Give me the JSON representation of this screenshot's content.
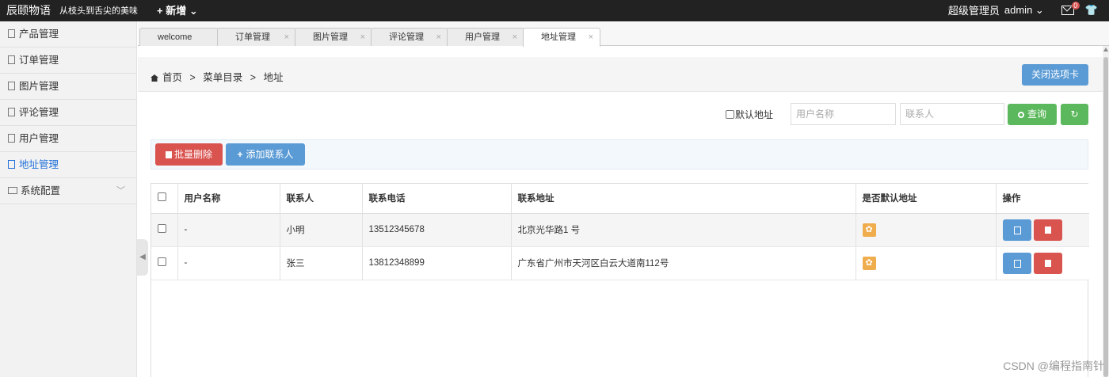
{
  "header": {
    "brand": "辰颐物语",
    "slogan": "从枝头到舌尖的美味",
    "new_label": "+ 新增 ⌄",
    "role": "超级管理员",
    "user": "admin ⌄",
    "mail_badge": "0"
  },
  "sidebar": {
    "items": [
      {
        "label": "产品管理"
      },
      {
        "label": "订单管理"
      },
      {
        "label": "图片管理"
      },
      {
        "label": "评论管理"
      },
      {
        "label": "用户管理"
      },
      {
        "label": "地址管理"
      },
      {
        "label": "系统配置"
      }
    ],
    "active_index": 5
  },
  "tabs": [
    {
      "label": "welcome"
    },
    {
      "label": "订单管理"
    },
    {
      "label": "图片管理"
    },
    {
      "label": "评论管理"
    },
    {
      "label": "用户管理"
    },
    {
      "label": "地址管理"
    }
  ],
  "breadcrumb": {
    "home": "首页",
    "sep": ">",
    "menu": "菜单目录",
    "current": "地址"
  },
  "close_tabs_label": "关闭选项卡",
  "search": {
    "default_label": "默认地址",
    "username_placeholder": "用户名称",
    "contact_placeholder": "联系人",
    "search_label": "查询"
  },
  "actions": {
    "batch_delete": "批量删除",
    "add_contact": "添加联系人"
  },
  "table": {
    "headers": [
      "用户名称",
      "联系人",
      "联系电话",
      "联系地址",
      "是否默认地址",
      "操作"
    ],
    "rows": [
      {
        "username": "-",
        "contact": "小明",
        "phone": "13512345678",
        "address": "北京光华路1 号"
      },
      {
        "username": "-",
        "contact": "张三",
        "phone": "13812348899",
        "address": "广东省广州市天河区白云大道南112号"
      }
    ]
  },
  "watermark": "CSDN @编程指南针",
  "colors": {
    "topbar": "#222222",
    "primary": "#5b9bd5",
    "success": "#5cb85c",
    "danger": "#d9534f",
    "warning": "#f0ad4e",
    "active_link": "#1e6fd9"
  }
}
